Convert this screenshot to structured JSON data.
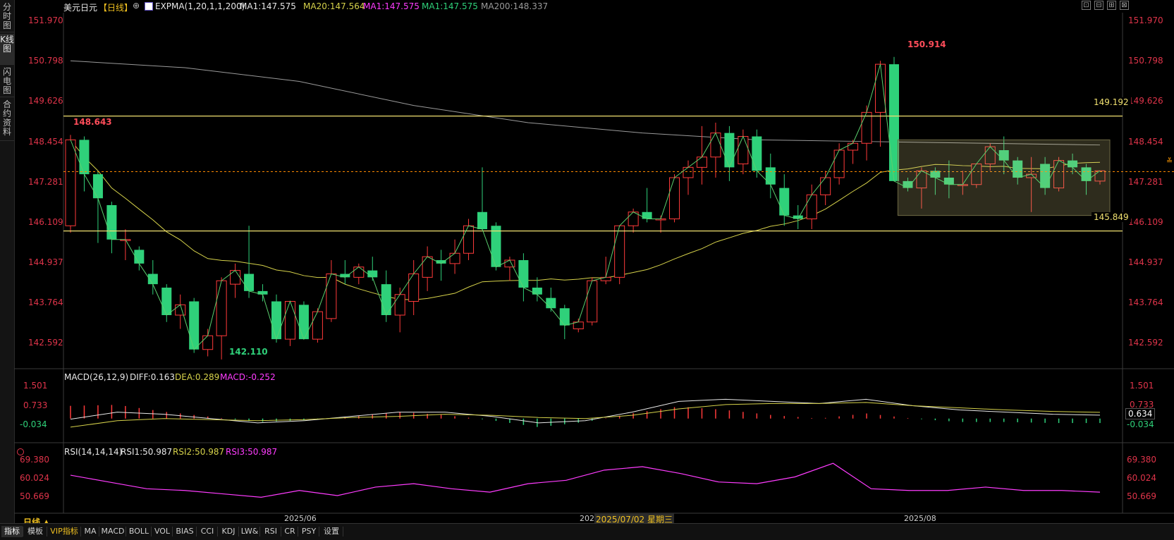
{
  "sidebar": {
    "items": [
      {
        "label": "分时图"
      },
      {
        "label": "K线图"
      },
      {
        "label": "闪电图"
      },
      {
        "label": "合约资料"
      }
    ]
  },
  "header": {
    "symbol": "美元日元",
    "period": "【日线】",
    "expma": "EXPMA(1,20,1,1,200)",
    "ma1": "MA1:147.575",
    "ma20": "MA20:147.564",
    "ma1b": "MA1:147.575",
    "ma1c": "MA1:147.575",
    "ma200": "MA200:148.337"
  },
  "window_buttons": [
    "⊡",
    "⊟",
    "⊞",
    "⊠"
  ],
  "main_axis": {
    "labels": [
      "151.970",
      "150.798",
      "149.626",
      "148.454",
      "147.281",
      "146.109",
      "144.937",
      "143.764",
      "142.592"
    ],
    "tags": {
      "resistance": "149.192",
      "support": "145.849"
    }
  },
  "annotations": {
    "high": "150.914",
    "start": "148.643",
    "low": "142.110"
  },
  "macd": {
    "title": "MACD(26,12,9)",
    "diff": "DIFF:0.163",
    "dea": "DEA:0.289",
    "macd": "MACD:-0.252",
    "axis": [
      "1.501",
      "0.733",
      "-0.034"
    ],
    "current": "0.634"
  },
  "rsi": {
    "title": "RSI(14,14,14)",
    "rsi1": "RSI1:50.987",
    "rsi2": "RSI2:50.987",
    "rsi3": "RSI3:50.987",
    "axis": [
      "69.380",
      "60.024",
      "50.669"
    ]
  },
  "time_axis": {
    "june": "2025/06",
    "prefix": "202",
    "cursor": "2025/07/02 星期三",
    "aug": "2025/08"
  },
  "bottom": {
    "period_label": "日线 ▲",
    "tabs": [
      "指标",
      "模板",
      "VIP指标",
      "MA",
      "MACD",
      "BOLL",
      "VOL",
      "BIAS",
      "CCI",
      "KDJ",
      "LW&",
      "RSI",
      "CR",
      "PSY",
      "设置"
    ]
  },
  "colors": {
    "up": "#ff3a3a",
    "down": "#2fd17a",
    "ma20": "#d6d24a",
    "ma200": "#9a9a9a",
    "rsi": "#ff3cff",
    "axis": "#e0344a"
  },
  "chart_data": {
    "type": "candlestick",
    "title": "美元日元【日线】",
    "ylim": [
      141.8,
      152.2
    ],
    "horizontal_lines": [
      149.192,
      145.849
    ],
    "current_price": 147.575,
    "candles": [
      {
        "o": 146.0,
        "h": 148.643,
        "l": 145.8,
        "c": 148.5
      },
      {
        "o": 148.5,
        "h": 148.6,
        "l": 147.0,
        "c": 147.5
      },
      {
        "o": 147.5,
        "h": 147.6,
        "l": 145.5,
        "c": 146.8
      },
      {
        "o": 146.6,
        "h": 146.7,
        "l": 145.2,
        "c": 145.6
      },
      {
        "o": 145.6,
        "h": 145.9,
        "l": 145.0,
        "c": 145.6
      },
      {
        "o": 145.3,
        "h": 145.4,
        "l": 144.7,
        "c": 144.9
      },
      {
        "o": 144.6,
        "h": 145.0,
        "l": 144.0,
        "c": 144.3
      },
      {
        "o": 144.2,
        "h": 144.3,
        "l": 143.2,
        "c": 143.4
      },
      {
        "o": 143.4,
        "h": 144.0,
        "l": 143.0,
        "c": 143.7
      },
      {
        "o": 143.8,
        "h": 143.9,
        "l": 142.3,
        "c": 142.4
      },
      {
        "o": 142.4,
        "h": 143.0,
        "l": 142.2,
        "c": 142.8
      },
      {
        "o": 142.8,
        "h": 144.5,
        "l": 142.11,
        "c": 144.4
      },
      {
        "o": 144.3,
        "h": 144.9,
        "l": 143.9,
        "c": 144.7
      },
      {
        "o": 144.6,
        "h": 146.0,
        "l": 143.9,
        "c": 144.1
      },
      {
        "o": 144.1,
        "h": 144.3,
        "l": 143.8,
        "c": 144.0
      },
      {
        "o": 143.8,
        "h": 144.0,
        "l": 142.6,
        "c": 142.7
      },
      {
        "o": 142.7,
        "h": 143.8,
        "l": 142.5,
        "c": 143.8
      },
      {
        "o": 143.7,
        "h": 143.8,
        "l": 142.7,
        "c": 142.7
      },
      {
        "o": 142.7,
        "h": 143.6,
        "l": 142.6,
        "c": 143.5
      },
      {
        "o": 143.3,
        "h": 145.0,
        "l": 143.2,
        "c": 144.6
      },
      {
        "o": 144.6,
        "h": 145.0,
        "l": 144.3,
        "c": 144.5
      },
      {
        "o": 144.5,
        "h": 144.9,
        "l": 144.3,
        "c": 144.8
      },
      {
        "o": 144.7,
        "h": 145.1,
        "l": 144.4,
        "c": 144.5
      },
      {
        "o": 144.3,
        "h": 144.7,
        "l": 143.2,
        "c": 143.4
      },
      {
        "o": 143.4,
        "h": 144.2,
        "l": 142.9,
        "c": 144.0
      },
      {
        "o": 143.8,
        "h": 145.0,
        "l": 143.4,
        "c": 144.6
      },
      {
        "o": 144.5,
        "h": 145.4,
        "l": 144.1,
        "c": 145.1
      },
      {
        "o": 145.0,
        "h": 145.3,
        "l": 144.4,
        "c": 144.9
      },
      {
        "o": 144.9,
        "h": 145.6,
        "l": 144.6,
        "c": 145.2
      },
      {
        "o": 145.2,
        "h": 146.2,
        "l": 145.0,
        "c": 146.0
      },
      {
        "o": 146.4,
        "h": 147.7,
        "l": 145.9,
        "c": 145.9
      },
      {
        "o": 146.0,
        "h": 146.1,
        "l": 144.7,
        "c": 144.8
      },
      {
        "o": 144.8,
        "h": 145.1,
        "l": 144.4,
        "c": 145.0
      },
      {
        "o": 145.0,
        "h": 145.2,
        "l": 143.8,
        "c": 144.2
      },
      {
        "o": 144.2,
        "h": 144.5,
        "l": 143.8,
        "c": 144.0
      },
      {
        "o": 143.9,
        "h": 144.2,
        "l": 143.5,
        "c": 143.6
      },
      {
        "o": 143.6,
        "h": 143.7,
        "l": 142.7,
        "c": 143.1
      },
      {
        "o": 143.0,
        "h": 143.3,
        "l": 142.9,
        "c": 143.2
      },
      {
        "o": 143.2,
        "h": 144.5,
        "l": 143.1,
        "c": 144.4
      },
      {
        "o": 144.4,
        "h": 145.1,
        "l": 144.3,
        "c": 144.5
      },
      {
        "o": 144.5,
        "h": 145.6,
        "l": 144.3,
        "c": 146.0
      },
      {
        "o": 146.0,
        "h": 146.5,
        "l": 145.8,
        "c": 146.4
      },
      {
        "o": 146.4,
        "h": 147.1,
        "l": 146.1,
        "c": 146.2
      },
      {
        "o": 146.2,
        "h": 146.3,
        "l": 145.8,
        "c": 146.2
      },
      {
        "o": 146.2,
        "h": 147.5,
        "l": 146.1,
        "c": 147.4
      },
      {
        "o": 147.4,
        "h": 147.9,
        "l": 146.9,
        "c": 147.7
      },
      {
        "o": 147.7,
        "h": 148.9,
        "l": 147.2,
        "c": 148.0
      },
      {
        "o": 148.0,
        "h": 149.0,
        "l": 147.4,
        "c": 148.7
      },
      {
        "o": 148.7,
        "h": 148.9,
        "l": 147.3,
        "c": 147.7
      },
      {
        "o": 147.8,
        "h": 148.8,
        "l": 147.5,
        "c": 148.6
      },
      {
        "o": 148.6,
        "h": 148.8,
        "l": 147.4,
        "c": 147.6
      },
      {
        "o": 147.7,
        "h": 148.1,
        "l": 146.8,
        "c": 147.2
      },
      {
        "o": 147.1,
        "h": 147.5,
        "l": 146.0,
        "c": 146.3
      },
      {
        "o": 146.3,
        "h": 146.6,
        "l": 145.9,
        "c": 146.2
      },
      {
        "o": 146.2,
        "h": 147.2,
        "l": 145.9,
        "c": 146.9
      },
      {
        "o": 146.9,
        "h": 147.6,
        "l": 146.6,
        "c": 147.4
      },
      {
        "o": 147.4,
        "h": 148.4,
        "l": 147.2,
        "c": 148.2
      },
      {
        "o": 148.2,
        "h": 148.5,
        "l": 147.8,
        "c": 148.4
      },
      {
        "o": 148.4,
        "h": 149.5,
        "l": 147.9,
        "c": 149.3
      },
      {
        "o": 149.3,
        "h": 150.8,
        "l": 148.3,
        "c": 150.7
      },
      {
        "o": 150.7,
        "h": 150.914,
        "l": 147.3,
        "c": 147.3
      },
      {
        "o": 147.3,
        "h": 147.4,
        "l": 147.0,
        "c": 147.1
      },
      {
        "o": 147.1,
        "h": 147.7,
        "l": 146.5,
        "c": 147.6
      },
      {
        "o": 147.6,
        "h": 147.7,
        "l": 146.9,
        "c": 147.4
      },
      {
        "o": 147.4,
        "h": 147.9,
        "l": 146.8,
        "c": 147.2
      },
      {
        "o": 147.2,
        "h": 147.6,
        "l": 146.9,
        "c": 147.2
      },
      {
        "o": 147.2,
        "h": 147.8,
        "l": 147.1,
        "c": 147.8
      },
      {
        "o": 147.8,
        "h": 148.4,
        "l": 147.6,
        "c": 148.3
      },
      {
        "o": 148.2,
        "h": 148.6,
        "l": 147.5,
        "c": 147.9
      },
      {
        "o": 147.9,
        "h": 148.0,
        "l": 147.2,
        "c": 147.4
      },
      {
        "o": 147.4,
        "h": 148.0,
        "l": 146.4,
        "c": 147.5
      },
      {
        "o": 147.8,
        "h": 148.0,
        "l": 146.9,
        "c": 147.1
      },
      {
        "o": 147.1,
        "h": 148.0,
        "l": 147.0,
        "c": 147.9
      },
      {
        "o": 147.9,
        "h": 148.1,
        "l": 147.5,
        "c": 147.7
      },
      {
        "o": 147.7,
        "h": 147.8,
        "l": 146.9,
        "c": 147.3
      },
      {
        "o": 147.3,
        "h": 147.6,
        "l": 147.2,
        "c": 147.6
      }
    ],
    "ma200_series": [
      150.8,
      150.6,
      150.2,
      149.5,
      149.0,
      148.7,
      148.5,
      148.45,
      148.4,
      148.35
    ],
    "macd_series": {
      "diff": [
        -0.03,
        0.3,
        0.2,
        0.0,
        -0.2,
        -0.1,
        0.1,
        0.3,
        0.3,
        0.1,
        -0.2,
        -0.1,
        0.3,
        0.8,
        0.9,
        0.8,
        0.7,
        0.9,
        0.6,
        0.4,
        0.3,
        0.2,
        0.16
      ],
      "dea": [
        -0.4,
        -0.1,
        0.0,
        -0.05,
        -0.1,
        -0.05,
        0.05,
        0.1,
        0.2,
        0.15,
        0.05,
        0.0,
        0.15,
        0.45,
        0.65,
        0.7,
        0.7,
        0.75,
        0.6,
        0.5,
        0.4,
        0.33,
        0.29
      ]
    },
    "rsi_series": [
      61,
      57,
      53,
      52,
      50,
      48,
      52,
      49,
      54,
      56,
      53,
      51,
      56,
      58,
      64,
      66,
      62,
      57,
      56,
      60,
      68,
      53,
      52,
      52,
      54,
      52,
      52,
      51
    ]
  }
}
